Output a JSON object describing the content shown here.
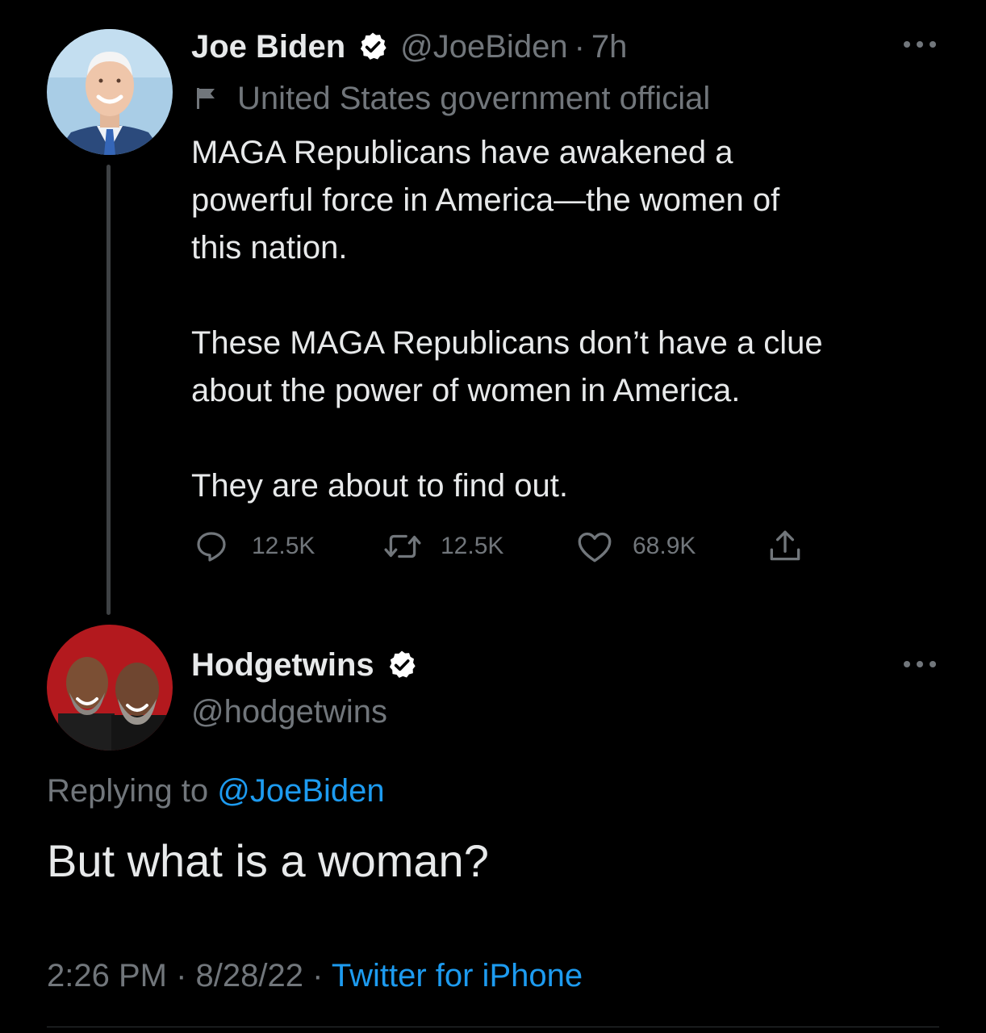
{
  "colors": {
    "background": "#000000",
    "text_primary": "#e7e9ea",
    "text_muted": "#71767b",
    "link": "#1d9bf0",
    "verified_badge_fill": "#ffffff",
    "thread_line": "#3e4144"
  },
  "tweet": {
    "author_name": "Joe Biden",
    "handle": "@JoeBiden",
    "separator": "·",
    "time_ago": "7h",
    "label_icon": "flag-icon",
    "label": "United States government official",
    "text_lines": [
      "MAGA Republicans have awakened a",
      "powerful force in America—the women of",
      "this nation.",
      "These MAGA Republicans don’t have a clue",
      "about the power of women in America.",
      "They are about to find out."
    ],
    "actions": {
      "reply": {
        "icon": "reply-icon",
        "count": "12.5K"
      },
      "retweet": {
        "icon": "retweet-icon",
        "count": "12.5K"
      },
      "like": {
        "icon": "heart-icon",
        "count": "68.9K"
      },
      "share": {
        "icon": "share-icon"
      }
    },
    "more_icon": "more-icon"
  },
  "reply": {
    "author_name": "Hodgetwins",
    "handle": "@hodgetwins",
    "replying_prefix": "Replying to",
    "replying_to": "@JoeBiden",
    "text": "But what is a woman?",
    "time": "2:26 PM",
    "separator": "·",
    "date": "8/28/22",
    "source": "Twitter for iPhone",
    "more_icon": "more-icon"
  }
}
